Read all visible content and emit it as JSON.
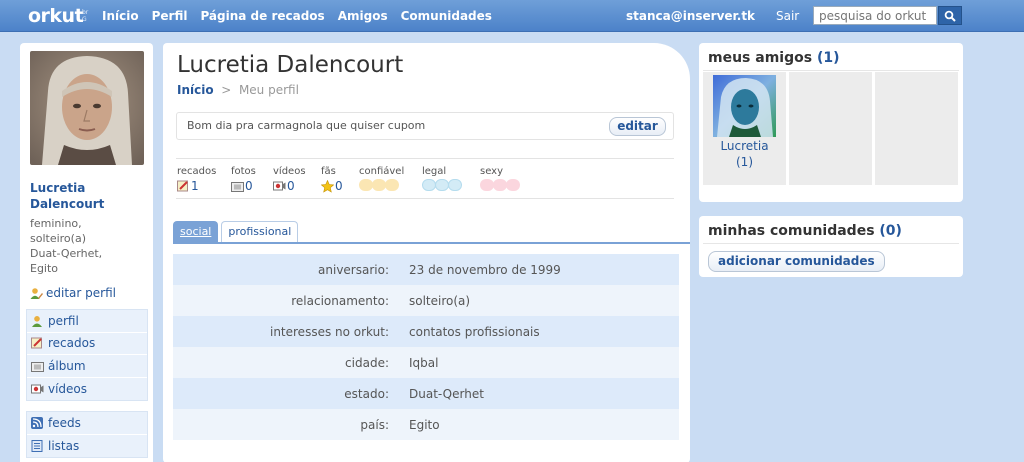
{
  "topbar": {
    "logo": "orkut",
    "logo_sup": [
      "br",
      "G"
    ],
    "nav": [
      "Início",
      "Perfil",
      "Página de recados",
      "Amigos",
      "Comunidades"
    ],
    "user_email": "stanca@inserver.tk",
    "logout": "Sair",
    "search_placeholder": "pesquisa do orkut"
  },
  "sidebar": {
    "name_line1": "Lucretia",
    "name_line2": "Dalencourt",
    "info": [
      "feminino,",
      "solteiro(a)",
      "Duat-Qerhet,",
      "Egito"
    ],
    "edit_profile": "editar perfil",
    "menu1": [
      {
        "label": "perfil",
        "icon": "user-icon"
      },
      {
        "label": "recados",
        "icon": "scrap-icon"
      },
      {
        "label": "álbum",
        "icon": "camera-icon"
      },
      {
        "label": "vídeos",
        "icon": "video-icon"
      }
    ],
    "menu2": [
      {
        "label": "feeds",
        "icon": "feed-icon"
      },
      {
        "label": "listas",
        "icon": "list-icon"
      }
    ]
  },
  "profile": {
    "title": "Lucretia Dalencourt",
    "breadcrumb_home": "Início",
    "breadcrumb_sep": ">",
    "breadcrumb_current": "Meu perfil",
    "status": "Bom dia pra carmagnola que quiser cupom",
    "edit_label": "editar",
    "stats": {
      "recados": {
        "label": "recados",
        "value": "1"
      },
      "fotos": {
        "label": "fotos",
        "value": "0"
      },
      "videos": {
        "label": "vídeos",
        "value": "0"
      },
      "fas": {
        "label": "fãs",
        "value": "0"
      },
      "confiavel": {
        "label": "confiável"
      },
      "legal": {
        "label": "legal"
      },
      "sexy": {
        "label": "sexy"
      }
    },
    "tabs": [
      "social",
      "profissional"
    ],
    "info_rows": [
      {
        "key": "aniversario:",
        "value": "23 de novembro de 1999"
      },
      {
        "key": "relacionamento:",
        "value": "solteiro(a)"
      },
      {
        "key": "interesses no orkut:",
        "value": "contatos profissionais"
      },
      {
        "key": "cidade:",
        "value": "Iqbal"
      },
      {
        "key": "estado:",
        "value": "Duat-Qerhet"
      },
      {
        "key": "país:",
        "value": "Egito"
      }
    ]
  },
  "friends": {
    "title": "meus amigos",
    "count": "(1)",
    "items": [
      {
        "name": "Lucretia",
        "count": "(1)"
      }
    ]
  },
  "communities": {
    "title": "minhas comunidades",
    "count": "(0)",
    "add_label": "adicionar comunidades"
  },
  "colors": {
    "accent": "#26579a",
    "topbar": "#5b8ed0",
    "background": "#c9dcf3",
    "row_alt": "#ddeafa"
  }
}
